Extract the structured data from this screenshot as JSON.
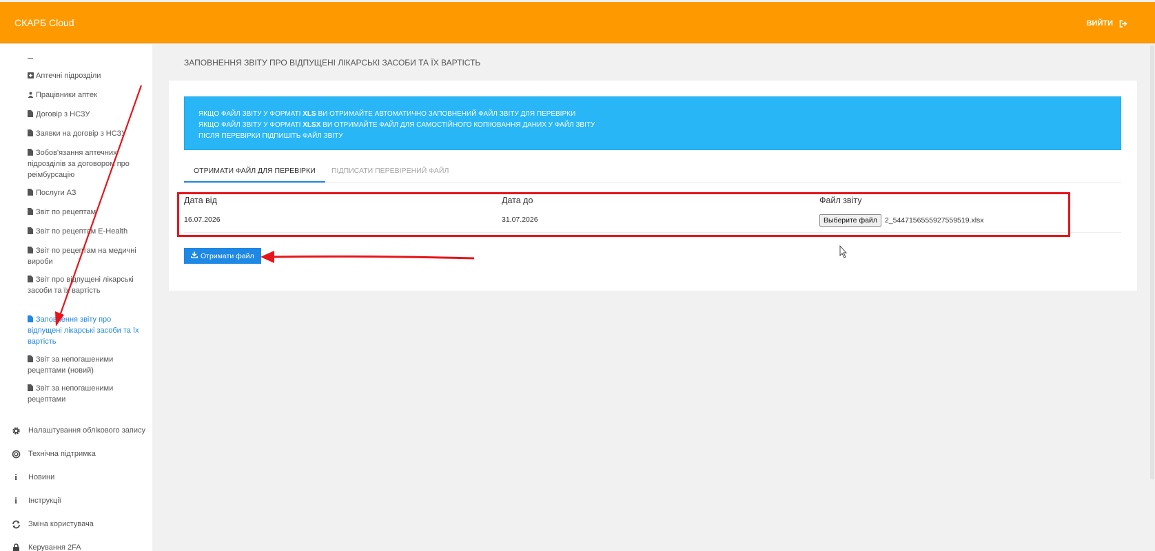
{
  "header": {
    "brand": "СКАРБ Cloud",
    "logout_label": "ВИЙТИ",
    "logout_icon": "sign-out-icon"
  },
  "sidebar": {
    "collapse_marker": "–",
    "sub_items": [
      {
        "label": "Аптечні підрозділи",
        "icon": "plus-square-icon"
      },
      {
        "label": "Працівники аптек",
        "icon": "users-icon"
      },
      {
        "label": "Договір з НСЗУ",
        "icon": "file-icon"
      },
      {
        "label": "Заявки на договір з НСЗУ",
        "icon": "file-icon"
      },
      {
        "label": "Зобов'язання аптечних підрозділів за договором про реімбурсацію",
        "icon": "file-icon"
      },
      {
        "label": "Послуги АЗ",
        "icon": "file-icon"
      },
      {
        "label": "Звіт по рецептам",
        "icon": "file-icon"
      },
      {
        "label": "Звіт по рецептам E-Health",
        "icon": "file-icon"
      },
      {
        "label": "Звіт по рецептам на медичні вироби",
        "icon": "file-icon"
      },
      {
        "label": "Звіт про відпущені лікарські засоби та їх вартість",
        "icon": "file-icon"
      },
      {
        "label": "Заповнення звіту про відпущені лікарські засоби та їх вартість",
        "icon": "file-icon",
        "active": true
      },
      {
        "label": "Звіт за непогашеними рецептами (новий)",
        "icon": "file-icon"
      },
      {
        "label": "Звіт за непогашеними рецептами",
        "icon": "file-icon"
      }
    ],
    "main_items": [
      {
        "label": "Налаштування облікового запису",
        "icon": "gear-icon"
      },
      {
        "label": "Технічна підтримка",
        "icon": "lifebuoy-icon"
      },
      {
        "label": "Новини",
        "icon": "info-icon"
      },
      {
        "label": "Інструкції",
        "icon": "info-icon"
      },
      {
        "label": "Зміна користувача",
        "icon": "refresh-icon"
      },
      {
        "label": "Керування 2FA",
        "icon": "lock-icon"
      }
    ]
  },
  "page": {
    "title": "ЗАПОВНЕННЯ ЗВІТУ ПРО ВІДПУЩЕНІ ЛІКАРСЬКІ ЗАСОБИ ТА ЇХ ВАРТІСТЬ"
  },
  "alert": {
    "line1_pre": "ЯКЩО ФАЙЛ ЗВІТУ У ФОРМАТІ ",
    "line1_fmt": "XLS",
    "line1_post": " ВИ ОТРИМАЙТЕ АВТОМАТИЧНО ЗАПОВНЕНИЙ ФАЙЛ ЗВІТУ ДЛЯ ПЕРЕВІРКИ",
    "line2_pre": "ЯКЩО ФАЙЛ ЗВІТУ У ФОРМАТІ ",
    "line2_fmt": "XLSX",
    "line2_post": " ВИ ОТРИМАЙТЕ ФАЙЛ ДЛЯ САМОСТІЙНОГО КОПІЮВАННЯ ДАНИХ У ФАЙЛ ЗВІТУ",
    "line3": "ПІСЛЯ ПЕРЕВІРКИ ПІДПИШІТЬ ФАЙЛ ЗВІТУ"
  },
  "tabs": [
    {
      "label": "ОТРИМАТИ ФАЙЛ ДЛЯ ПЕРЕВІРКИ",
      "active": true
    },
    {
      "label": "ПІДПИСАТИ ПЕРЕВІРЕНИЙ ФАЙЛ",
      "active": false
    }
  ],
  "form": {
    "date_from_label": "Дата від",
    "date_from_value": "16.07.2026",
    "date_to_label": "Дата до",
    "date_to_value": "31.07.2026",
    "file_label": "Файл звіту",
    "file_button": "Выберите файл",
    "file_name": "2_5447156555927559519.xlsx"
  },
  "actions": {
    "get_file_label": "Отримати файл",
    "get_file_icon": "download-icon"
  },
  "colors": {
    "header": "#fe9a00",
    "alert": "#29b6f6",
    "primary": "#1e88e5",
    "annotation": "#e8141b"
  }
}
